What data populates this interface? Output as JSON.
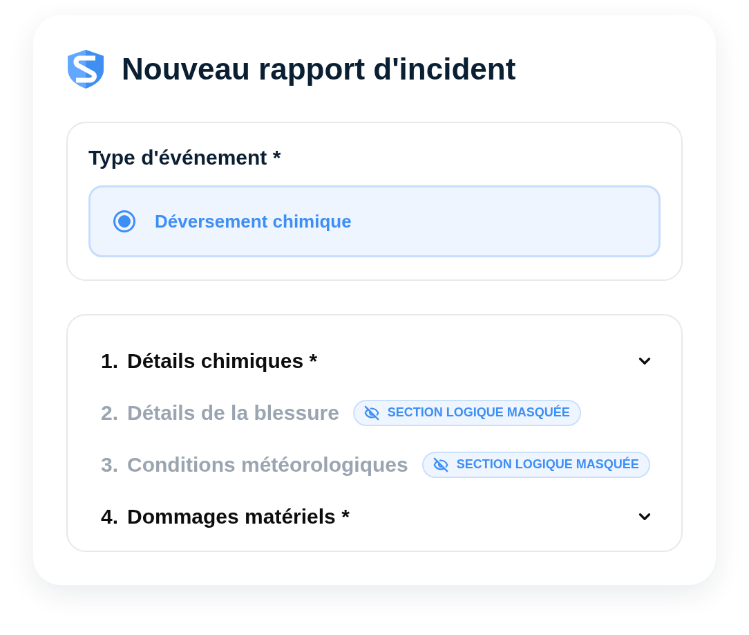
{
  "title": "Nouveau rapport d'incident",
  "event_type": {
    "label": "Type d'événement *",
    "options": [
      {
        "label": "Déversement chimique",
        "selected": true
      }
    ]
  },
  "sections": [
    {
      "number": "1.",
      "title": "Détails chimiques *",
      "hidden": false
    },
    {
      "number": "2.",
      "title": "Détails de la blessure",
      "hidden": true,
      "badge": "SECTION LOGIQUE MASQUÉE"
    },
    {
      "number": "3.",
      "title": "Conditions météorologiques",
      "hidden": true,
      "badge": "SECTION LOGIQUE MASQUÉE"
    },
    {
      "number": "4.",
      "title": "Dommages matériels *",
      "hidden": false
    }
  ]
}
